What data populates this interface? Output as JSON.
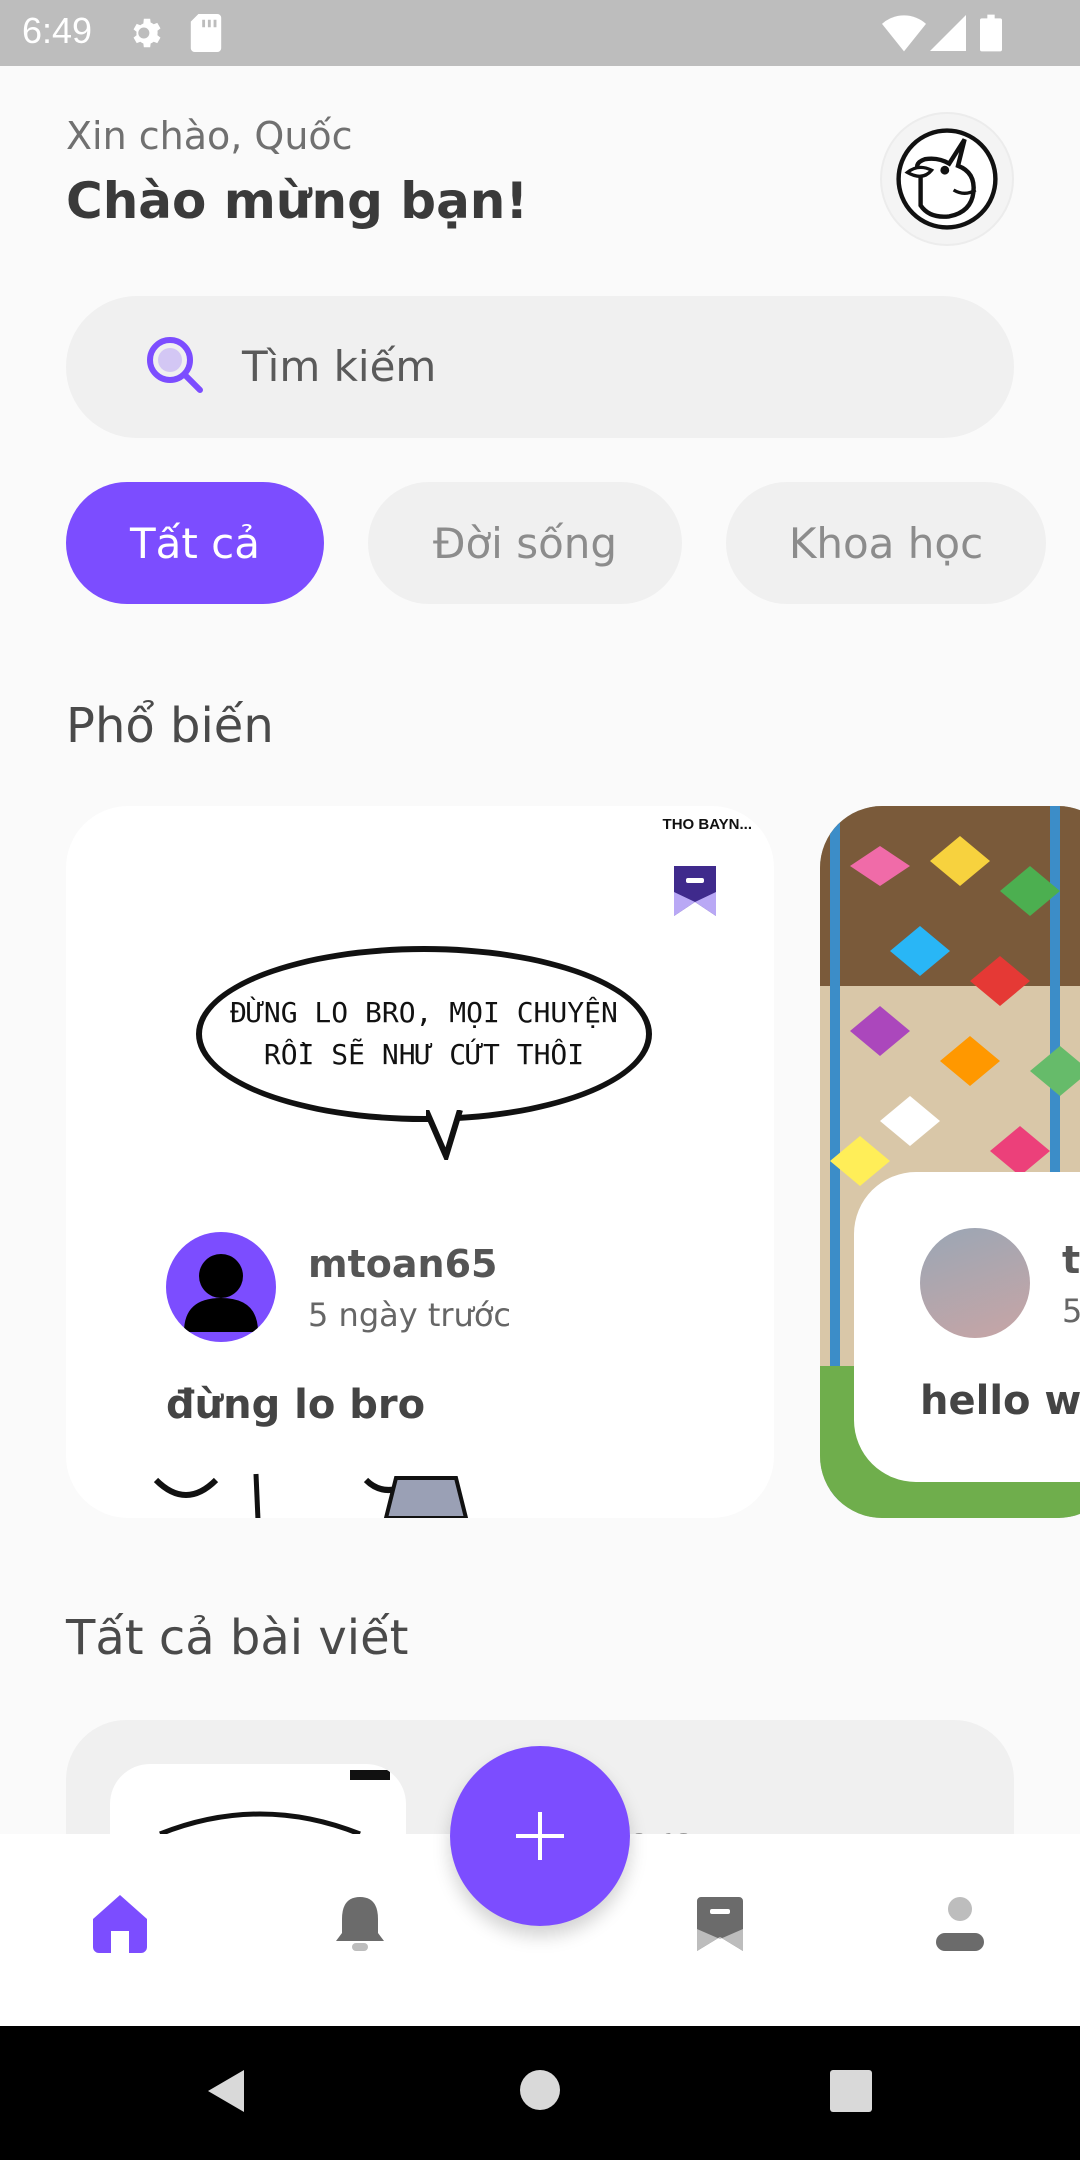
{
  "status_bar": {
    "time": "6:49"
  },
  "header": {
    "greeting": "Xin chào, Quốc",
    "welcome": "Chào mừng bạn!"
  },
  "search": {
    "placeholder": "Tìm kiếm"
  },
  "categories": [
    {
      "label": "Tất cả",
      "active": true
    },
    {
      "label": "Đời sống",
      "active": false
    },
    {
      "label": "Khoa học",
      "active": false
    }
  ],
  "popular": {
    "title": "Phổ biến",
    "cards": [
      {
        "author": "mtoan65",
        "time": "5 ngày trước",
        "title": "đừng lo bro",
        "comic_tag": "THO BAYN...",
        "comic_lines": [
          "ĐỪNG LO BRO, MỌI CHUYỆN",
          "RỒI SẼ NHƯ CỨT THÔI"
        ]
      },
      {
        "author": "t",
        "time": "5",
        "title": "hello wo"
      }
    ]
  },
  "all_posts": {
    "title": "Tất cả bài viết",
    "partial_text": "ero"
  },
  "colors": {
    "accent": "#7c4dff",
    "chip_inactive_bg": "#f0f0f0",
    "bg": "#fafafa"
  },
  "nav": {
    "items": [
      "home-icon",
      "bell-icon",
      "bookmark-icon",
      "profile-icon"
    ]
  }
}
